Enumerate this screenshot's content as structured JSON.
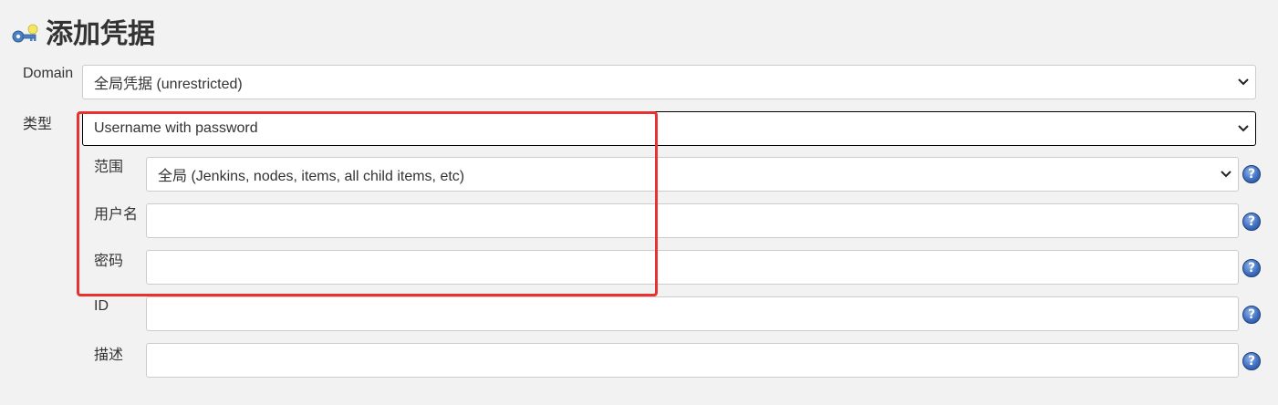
{
  "page": {
    "title": "添加凭据",
    "key_icon": "key-icon",
    "help_icon_glyph": "?"
  },
  "form": {
    "domain": {
      "label": "Domain",
      "value": "全局凭据 (unrestricted)"
    },
    "kind": {
      "label": "类型",
      "value": "Username with password"
    },
    "scope": {
      "label": "范围",
      "value": "全局 (Jenkins, nodes, items, all child items, etc)"
    },
    "username": {
      "label": "用户名",
      "value": ""
    },
    "password": {
      "label": "密码",
      "value": ""
    },
    "id": {
      "label": "ID",
      "value": ""
    },
    "description": {
      "label": "描述",
      "value": ""
    }
  },
  "colors": {
    "highlight_box": "#e8322f",
    "help_icon": "#3f6fc0",
    "background": "#f2f2f2"
  }
}
